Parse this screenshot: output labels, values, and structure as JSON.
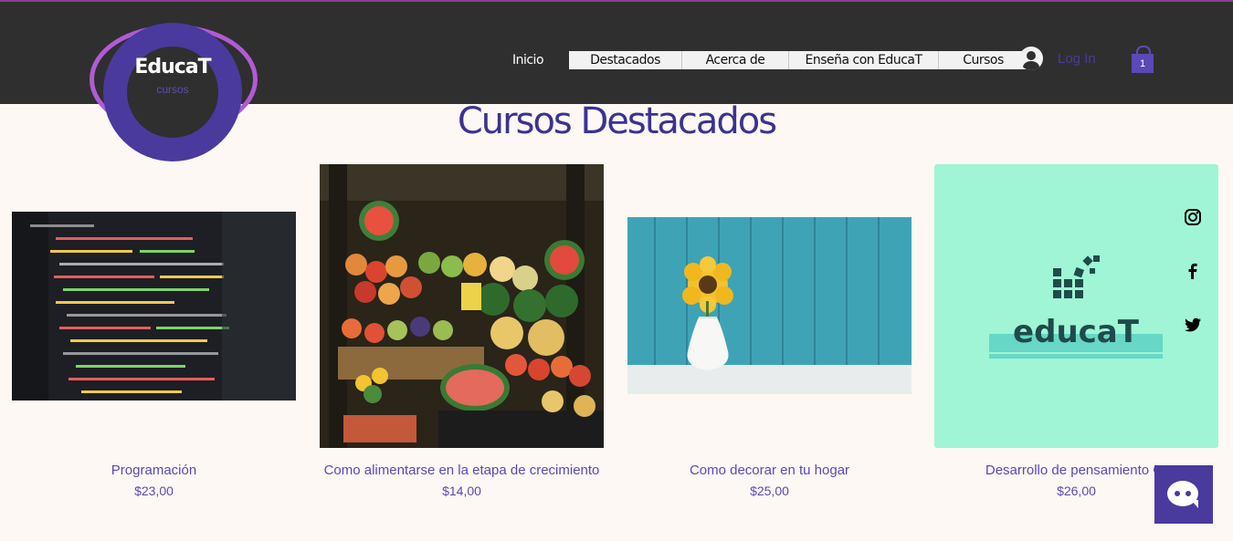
{
  "header": {
    "brand": "EducaT",
    "brand_sub": "cursos",
    "nav": [
      "Inicio",
      "Destacados",
      "Acerca de",
      "Enseña con EducaT",
      "Cursos"
    ],
    "login_label": "Log In",
    "cart_count": "1"
  },
  "main": {
    "title": "Cursos Destacados",
    "products": [
      {
        "name": "Programación",
        "price": "$23,00"
      },
      {
        "name": "Como alimentarse en la etapa de crecimiento",
        "price": "$14,00"
      },
      {
        "name": "Como decorar en tu hogar",
        "price": "$25,00"
      },
      {
        "name": "Desarrollo de pensamiento Cr",
        "price": "$26,00"
      }
    ],
    "educat_logo_text": "educaT"
  },
  "social": [
    "instagram-icon",
    "facebook-icon",
    "twitter-icon"
  ],
  "colors": {
    "accent": "#4a3a9e",
    "header_bg": "#2f2f2f",
    "page_bg": "#fdf8f4",
    "teal_card": "#9ff5d5"
  }
}
